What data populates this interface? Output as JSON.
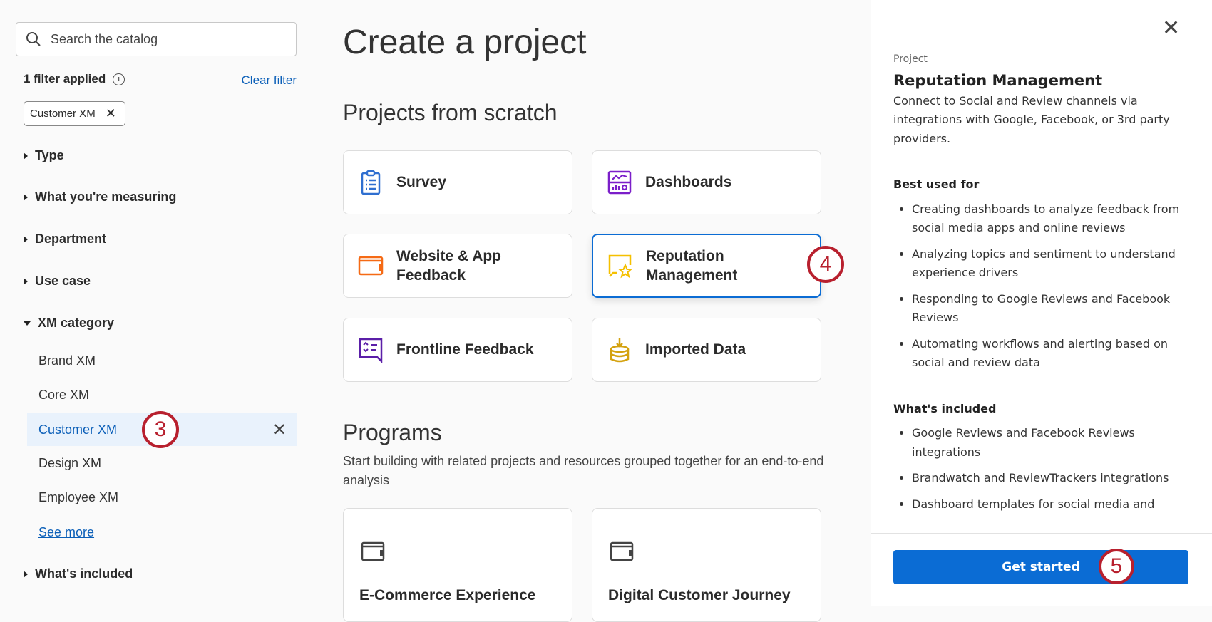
{
  "sidebar": {
    "search_placeholder": "Search the catalog",
    "filter_count": "1 filter applied",
    "clear_filter": "Clear filter",
    "chip": "Customer XM",
    "facets": {
      "type": "Type",
      "measuring": "What you're measuring",
      "department": "Department",
      "use_case": "Use case",
      "xm_category": "XM category",
      "whats_included": "What's included"
    },
    "xm_options": [
      "Brand XM",
      "Core XM",
      "Customer XM",
      "Design XM",
      "Employee XM"
    ],
    "see_more": "See more"
  },
  "main": {
    "title": "Create a project",
    "scratch_heading": "Projects from scratch",
    "cards": [
      "Survey",
      "Dashboards",
      "Website & App Feedback",
      "Reputation Management",
      "Frontline Feedback",
      "Imported Data"
    ],
    "programs_heading": "Programs",
    "programs_desc": "Start building with related projects and resources grouped together for an end-to-end analysis",
    "program_cards": [
      "E-Commerce Experience",
      "Digital Customer Journey"
    ]
  },
  "panel": {
    "label": "Project",
    "title": "Reputation Management",
    "desc": "Connect to Social and Review channels via integrations with Google, Facebook, or 3rd party providers.",
    "best_heading": "Best used for",
    "best": [
      "Creating dashboards to analyze feedback from social media apps and online reviews",
      "Analyzing topics and sentiment to understand experience drivers",
      "Responding to Google Reviews and Facebook Reviews",
      "Automating workflows and alerting based on social and review data"
    ],
    "included_heading": "What's included",
    "included": [
      "Google Reviews and Facebook Reviews integrations",
      "Brandwatch and ReviewTrackers integrations",
      "Dashboard templates for social media and"
    ],
    "cta": "Get started"
  },
  "annotations": {
    "step3": "3",
    "step4": "4",
    "step5": "5"
  },
  "colors": {
    "accent": "#0b6cd4",
    "badge": "#b8202e"
  }
}
